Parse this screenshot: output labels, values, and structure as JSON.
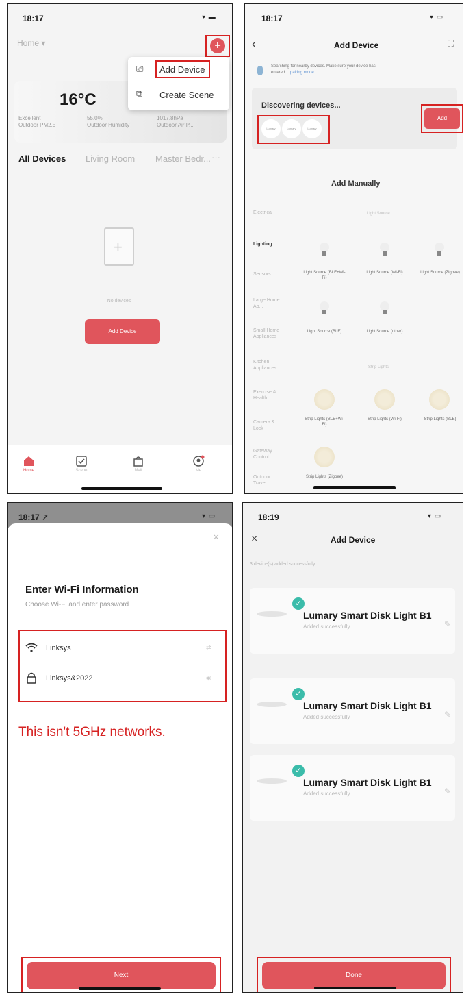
{
  "panel1": {
    "time": "18:17",
    "home_label": "Home ▾",
    "add_symbol": "+",
    "menu": {
      "add_device": "Add Device",
      "create_scene": "Create Scene"
    },
    "weather": {
      "temp": "16°C",
      "col1_value": "Excellent",
      "col1_label": "Outdoor PM2.5",
      "col2_value": "55.0%",
      "col2_label": "Outdoor Humidity",
      "col3_value": "1017.8hPa",
      "col3_label": "Outdoor Air P..."
    },
    "tabs": {
      "all": "All Devices",
      "living": "Living Room",
      "master": "Master Bedr...",
      "more": "···"
    },
    "empty_text": "No devices",
    "add_device_button": "Add Device",
    "nav": {
      "home": "Home",
      "scene": "Scene",
      "mall": "Mall",
      "me": "Me"
    },
    "accent": "#e0555c"
  },
  "panel2": {
    "time": "18:17",
    "title": "Add Device",
    "back": "‹",
    "search_note_1": "Searching for nearby devices. Make sure your device has",
    "search_note_2": "entered",
    "search_note_link": "pairing mode.",
    "discovering": "Discovering devices...",
    "chips": [
      "Lumary",
      "Lumary",
      "Lumary"
    ],
    "add_button": "Add",
    "add_manually": "Add Manually",
    "categories": [
      "Electrical",
      "Lighting",
      "Sensors",
      "Large Home Ap...",
      "Small Home Appliances",
      "Kitchen Appliances",
      "Exercise & Health",
      "Camera & Lock",
      "Gateway Control",
      "Outdoor Travel"
    ],
    "section_light_source": "Light Source",
    "section_strip_lights": "Strip Lights",
    "light_devices": [
      "Light Source (BLE+Wi-Fi)",
      "Light Source (Wi-Fi)",
      "Light Source (Zigbee)",
      "Light Source (BLE)",
      "Light Source (other)"
    ],
    "strip_devices": [
      "Strip Lights (BLE+Wi-Fi)",
      "Strip Lights (Wi-Fi)",
      "Strip Lights (BLE)",
      "Strip Lights (Zigbee)"
    ]
  },
  "panel3": {
    "time": "18:17 ➚",
    "close": "×",
    "title": "Enter Wi-Fi Information",
    "subtitle": "Choose Wi-Fi and enter password",
    "ssid": "Linksys",
    "password": "Linksys&2022",
    "note": "This isn't 5GHz networks.",
    "next_button": "Next"
  },
  "panel4": {
    "time": "18:19",
    "close": "×",
    "title": "Add Device",
    "summary": "3 device(s) added successfully",
    "devices": [
      {
        "name": "Lumary Smart Disk Light B1",
        "status": "Added successfully"
      },
      {
        "name": "Lumary Smart Disk Light B1",
        "status": "Added successfully"
      },
      {
        "name": "Lumary Smart Disk Light B1",
        "status": "Added successfully"
      }
    ],
    "done_button": "Done"
  },
  "colors": {
    "highlight": "#d62222",
    "button_red": "#e0555c",
    "check_teal": "#3bbcaa"
  }
}
